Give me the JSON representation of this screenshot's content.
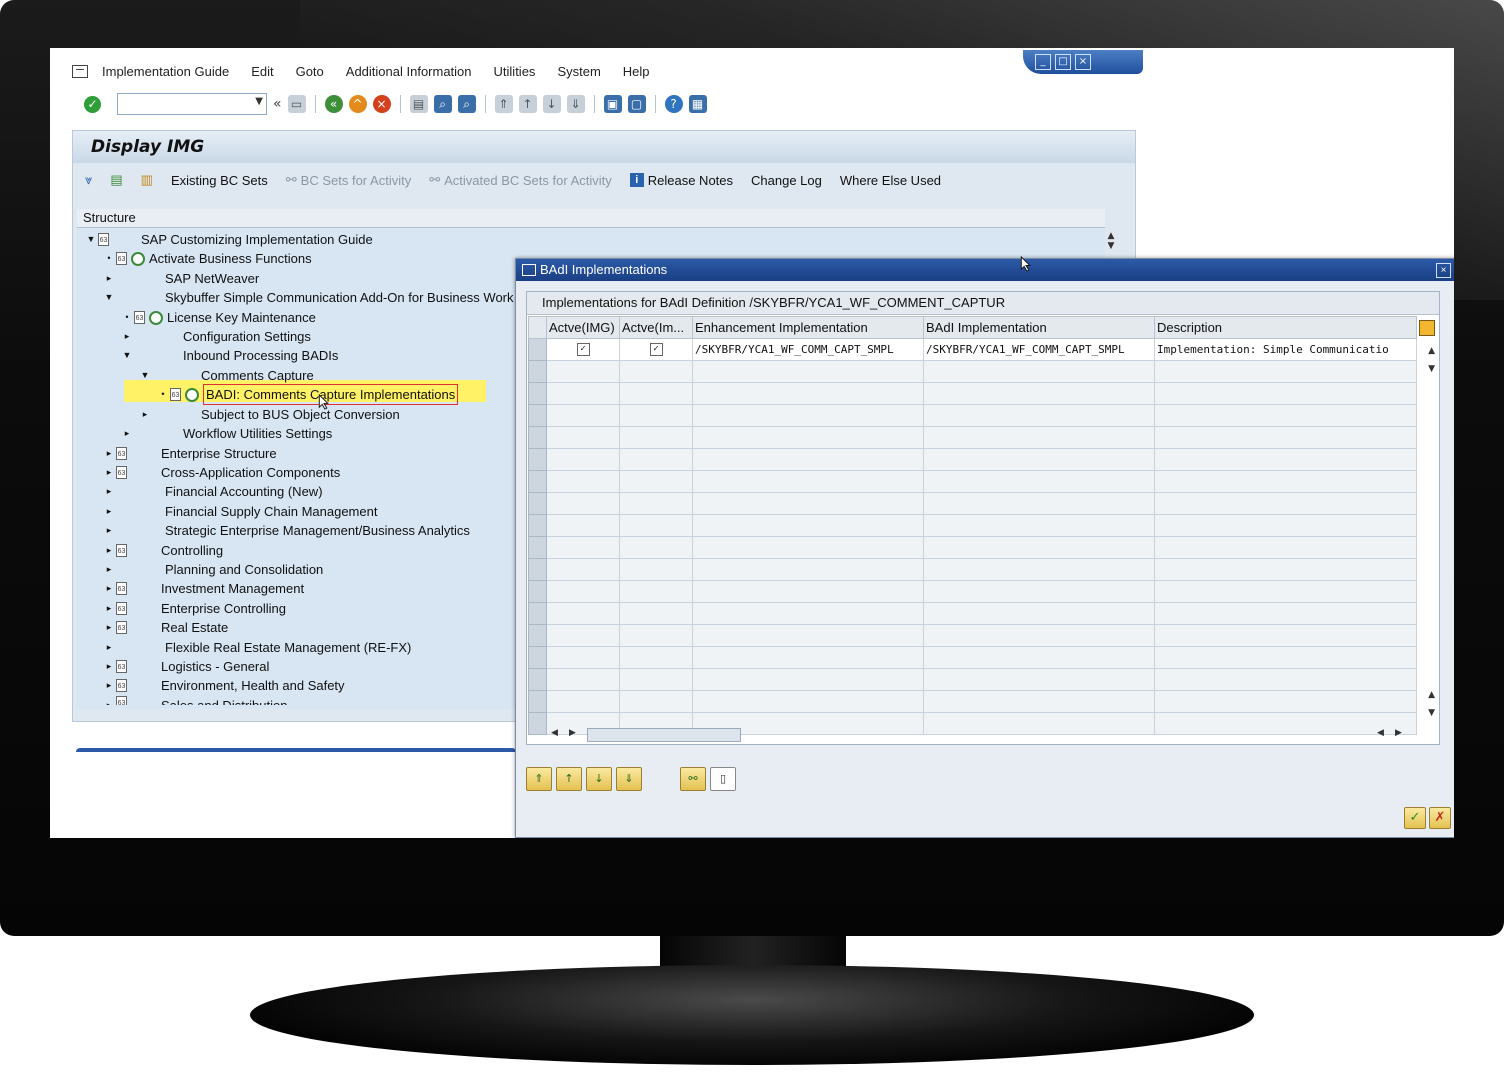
{
  "menu": [
    "Implementation Guide",
    "Edit",
    "Goto",
    "Additional Information",
    "Utilities",
    "System",
    "Help"
  ],
  "window_controls": [
    "_",
    "□",
    "×"
  ],
  "toolbar": {
    "command_field": {
      "value": "",
      "placeholder": ""
    }
  },
  "page_title": "Display IMG",
  "app_toolbar": {
    "existing_bc_sets": "Existing BC Sets",
    "bc_sets_for_activity": "BC Sets for Activity",
    "activated_bc_sets": "Activated BC Sets for Activity",
    "release_notes": "Release Notes",
    "change_log": "Change Log",
    "where_else_used": "Where Else Used"
  },
  "tree": {
    "header": "Structure",
    "nodes": [
      "SAP Customizing Implementation Guide",
      "Activate Business Functions",
      "SAP NetWeaver",
      "Skybuffer Simple Communication Add-On for Business Work",
      "License Key Maintenance",
      "Configuration Settings",
      "Inbound Processing BADIs",
      "Comments Capture",
      "BADI: Comments Capture Implementations",
      "Subject to BUS Object Conversion",
      "Workflow Utilities Settings",
      "Enterprise Structure",
      "Cross-Application Components",
      "Financial Accounting (New)",
      "Financial Supply Chain Management",
      "Strategic Enterprise Management/Business Analytics",
      "Controlling",
      "Planning and Consolidation",
      "Investment Management",
      "Enterprise Controlling",
      "Real Estate",
      "Flexible Real Estate Management (RE-FX)",
      "Logistics - General",
      "Environment, Health and Safety",
      "Sales and Distribution"
    ]
  },
  "dialog": {
    "title": "BAdI Implementations",
    "caption": "Implementations for BAdI Definition /SKYBFR/YCA1_WF_COMMENT_CAPTUR",
    "columns": [
      "Actve(IMG)",
      "Actve(Im...",
      "Enhancement Implementation",
      "BAdI Implementation",
      "Description"
    ],
    "rows": [
      {
        "active_img": "✓",
        "active_impl": "✓",
        "enhancement": "/SKYBFR/YCA1_WF_COMM_CAPT_SMPL",
        "badi": "/SKYBFR/YCA1_WF_COMM_CAPT_SMPL",
        "description": "Implementation: Simple Communicatio"
      }
    ]
  },
  "colors": {
    "sap_blue": "#1a3f84",
    "highlight": "#fff266",
    "tree_bg": "#d8e5f2"
  }
}
